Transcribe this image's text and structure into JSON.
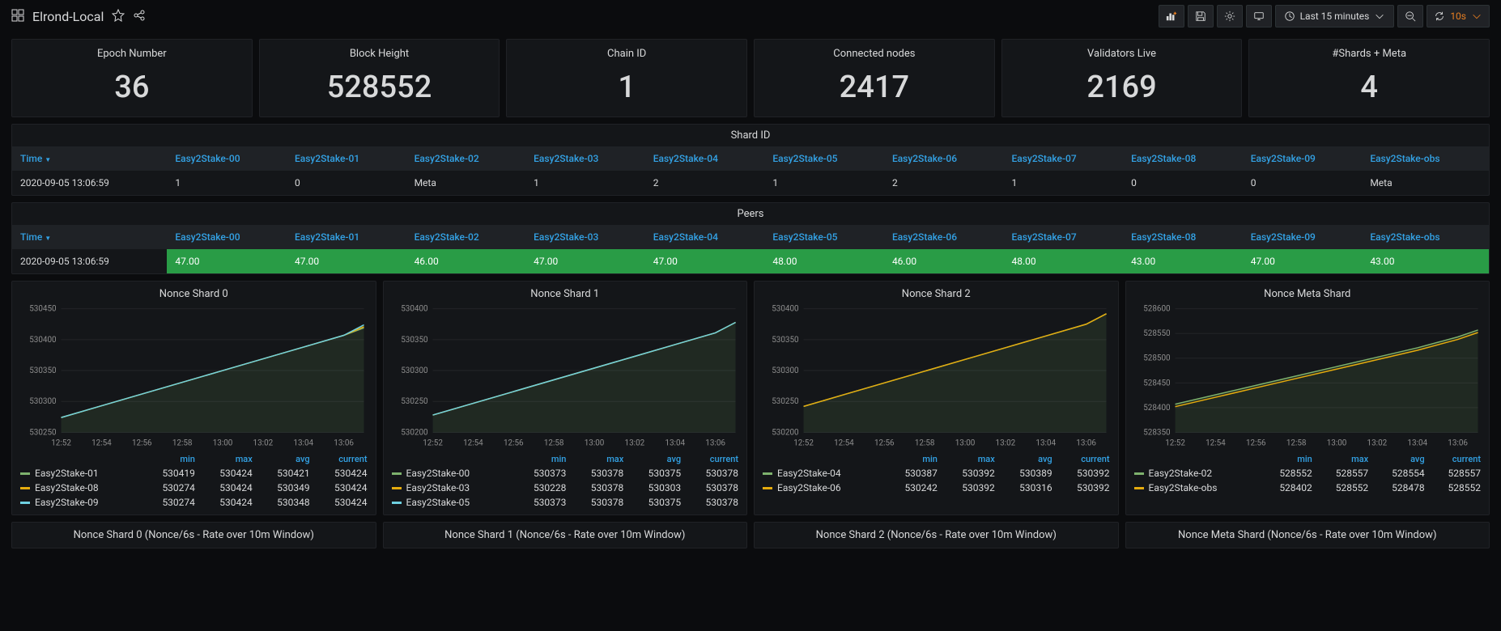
{
  "header": {
    "title": "Elrond-Local",
    "time_range": "Last 15 minutes",
    "refresh": "10s"
  },
  "stats": [
    {
      "label": "Epoch Number",
      "value": "36"
    },
    {
      "label": "Block Height",
      "value": "528552"
    },
    {
      "label": "Chain ID",
      "value": "1"
    },
    {
      "label": "Connected nodes",
      "value": "2417"
    },
    {
      "label": "Validators Live",
      "value": "2169"
    },
    {
      "label": "#Shards + Meta",
      "value": "4"
    }
  ],
  "columns": [
    "Time",
    "Easy2Stake-00",
    "Easy2Stake-01",
    "Easy2Stake-02",
    "Easy2Stake-03",
    "Easy2Stake-04",
    "Easy2Stake-05",
    "Easy2Stake-06",
    "Easy2Stake-07",
    "Easy2Stake-08",
    "Easy2Stake-09",
    "Easy2Stake-obs"
  ],
  "shard_table": {
    "title": "Shard ID",
    "row": [
      "2020-09-05 13:06:59",
      "1",
      "0",
      "Meta",
      "1",
      "2",
      "1",
      "2",
      "1",
      "0",
      "0",
      "Meta"
    ]
  },
  "peers_table": {
    "title": "Peers",
    "row": [
      "2020-09-05 13:06:59",
      "47.00",
      "47.00",
      "46.00",
      "47.00",
      "47.00",
      "48.00",
      "46.00",
      "48.00",
      "43.00",
      "47.00",
      "43.00"
    ]
  },
  "chart_data": [
    {
      "type": "line",
      "title": "Nonce Shard 0",
      "xlabel": "",
      "ylabel": "",
      "x_ticks": [
        "12:52",
        "12:54",
        "12:56",
        "12:58",
        "13:00",
        "13:02",
        "13:04",
        "13:06"
      ],
      "y_ticks": [
        530250,
        530300,
        530350,
        530400,
        530450
      ],
      "ylim": [
        530250,
        530450
      ],
      "series": [
        {
          "name": "Easy2Stake-01",
          "color": "#7eb26d",
          "x": [
            0,
            1,
            2,
            3,
            4,
            5,
            6,
            7,
            7.5
          ],
          "values": [
            530274,
            530293,
            530312,
            530331,
            530350,
            530369,
            530388,
            530407,
            530419
          ]
        },
        {
          "name": "Easy2Stake-08",
          "color": "#e5ac0e",
          "x": [
            0,
            1,
            2,
            3,
            4,
            5,
            6,
            7,
            7.5
          ],
          "values": [
            530274,
            530293,
            530312,
            530331,
            530350,
            530369,
            530388,
            530407,
            530421
          ]
        },
        {
          "name": "Easy2Stake-09",
          "color": "#6ed0e0",
          "x": [
            0,
            1,
            2,
            3,
            4,
            5,
            6,
            7,
            7.5
          ],
          "values": [
            530274,
            530293,
            530312,
            530331,
            530350,
            530369,
            530388,
            530407,
            530424
          ]
        }
      ],
      "legend": [
        {
          "name": "Easy2Stake-01",
          "color": "#7eb26d",
          "min": "530419",
          "max": "530424",
          "avg": "530421",
          "current": "530424"
        },
        {
          "name": "Easy2Stake-08",
          "color": "#e5ac0e",
          "min": "530274",
          "max": "530424",
          "avg": "530349",
          "current": "530424"
        },
        {
          "name": "Easy2Stake-09",
          "color": "#6ed0e0",
          "min": "530274",
          "max": "530424",
          "avg": "530348",
          "current": "530424"
        }
      ]
    },
    {
      "type": "line",
      "title": "Nonce Shard 1",
      "x_ticks": [
        "12:52",
        "12:54",
        "12:56",
        "12:58",
        "13:00",
        "13:02",
        "13:04",
        "13:06"
      ],
      "y_ticks": [
        530200,
        530250,
        530300,
        530350,
        530400
      ],
      "ylim": [
        530200,
        530400
      ],
      "series": [
        {
          "name": "Easy2Stake-00",
          "color": "#7eb26d",
          "x": [
            0,
            1,
            2,
            3,
            4,
            5,
            6,
            7,
            7.5
          ],
          "values": [
            530228,
            530247,
            530266,
            530285,
            530304,
            530323,
            530342,
            530361,
            530378
          ]
        },
        {
          "name": "Easy2Stake-03",
          "color": "#e5ac0e",
          "x": [
            0,
            1,
            2,
            3,
            4,
            5,
            6,
            7,
            7.5
          ],
          "values": [
            530228,
            530247,
            530266,
            530285,
            530304,
            530323,
            530342,
            530361,
            530378
          ]
        },
        {
          "name": "Easy2Stake-05",
          "color": "#6ed0e0",
          "x": [
            0,
            1,
            2,
            3,
            4,
            5,
            6,
            7,
            7.5
          ],
          "values": [
            530228,
            530247,
            530266,
            530285,
            530304,
            530323,
            530342,
            530361,
            530378
          ]
        }
      ],
      "legend": [
        {
          "name": "Easy2Stake-00",
          "color": "#7eb26d",
          "min": "530373",
          "max": "530378",
          "avg": "530375",
          "current": "530378"
        },
        {
          "name": "Easy2Stake-03",
          "color": "#e5ac0e",
          "min": "530228",
          "max": "530378",
          "avg": "530303",
          "current": "530378"
        },
        {
          "name": "Easy2Stake-05",
          "color": "#6ed0e0",
          "min": "530373",
          "max": "530378",
          "avg": "530375",
          "current": "530378"
        }
      ]
    },
    {
      "type": "line",
      "title": "Nonce Shard 2",
      "x_ticks": [
        "12:52",
        "12:54",
        "12:56",
        "12:58",
        "13:00",
        "13:02",
        "13:04",
        "13:06"
      ],
      "y_ticks": [
        530200,
        530250,
        530300,
        530350,
        530400
      ],
      "ylim": [
        530200,
        530400
      ],
      "series": [
        {
          "name": "Easy2Stake-04",
          "color": "#7eb26d",
          "x": [
            0,
            1,
            2,
            3,
            4,
            5,
            6,
            7,
            7.5
          ],
          "values": [
            530242,
            530261,
            530280,
            530299,
            530318,
            530337,
            530356,
            530375,
            530392
          ]
        },
        {
          "name": "Easy2Stake-06",
          "color": "#e5ac0e",
          "x": [
            0,
            1,
            2,
            3,
            4,
            5,
            6,
            7,
            7.5
          ],
          "values": [
            530242,
            530261,
            530280,
            530299,
            530318,
            530337,
            530356,
            530375,
            530392
          ]
        }
      ],
      "legend": [
        {
          "name": "Easy2Stake-04",
          "color": "#7eb26d",
          "min": "530387",
          "max": "530392",
          "avg": "530389",
          "current": "530392"
        },
        {
          "name": "Easy2Stake-06",
          "color": "#e5ac0e",
          "min": "530242",
          "max": "530392",
          "avg": "530316",
          "current": "530392"
        }
      ]
    },
    {
      "type": "line",
      "title": "Nonce Meta Shard",
      "x_ticks": [
        "12:52",
        "12:54",
        "12:56",
        "12:58",
        "13:00",
        "13:02",
        "13:04",
        "13:06"
      ],
      "y_ticks": [
        528350,
        528400,
        528450,
        528500,
        528550,
        528600
      ],
      "ylim": [
        528350,
        528600
      ],
      "series": [
        {
          "name": "Easy2Stake-02",
          "color": "#7eb26d",
          "x": [
            0,
            1,
            2,
            3,
            4,
            5,
            6,
            7,
            7.5
          ],
          "values": [
            528407,
            528426,
            528445,
            528464,
            528483,
            528502,
            528521,
            528543,
            528557
          ]
        },
        {
          "name": "Easy2Stake-obs",
          "color": "#e5ac0e",
          "x": [
            0,
            1,
            2,
            3,
            4,
            5,
            6,
            7,
            7.5
          ],
          "values": [
            528402,
            528421,
            528440,
            528459,
            528478,
            528497,
            528516,
            528538,
            528552
          ]
        }
      ],
      "legend": [
        {
          "name": "Easy2Stake-02",
          "color": "#7eb26d",
          "min": "528552",
          "max": "528557",
          "avg": "528554",
          "current": "528557"
        },
        {
          "name": "Easy2Stake-obs",
          "color": "#e5ac0e",
          "min": "528402",
          "max": "528552",
          "avg": "528478",
          "current": "528552"
        }
      ]
    }
  ],
  "rate_panels": [
    "Nonce Shard 0 (Nonce/6s - Rate over 10m Window)",
    "Nonce Shard 1 (Nonce/6s - Rate over 10m Window)",
    "Nonce Shard 2 (Nonce/6s - Rate over 10m Window)",
    "Nonce Meta Shard (Nonce/6s - Rate over 10m Window)"
  ],
  "legend_headers": [
    "min",
    "max",
    "avg",
    "current"
  ]
}
